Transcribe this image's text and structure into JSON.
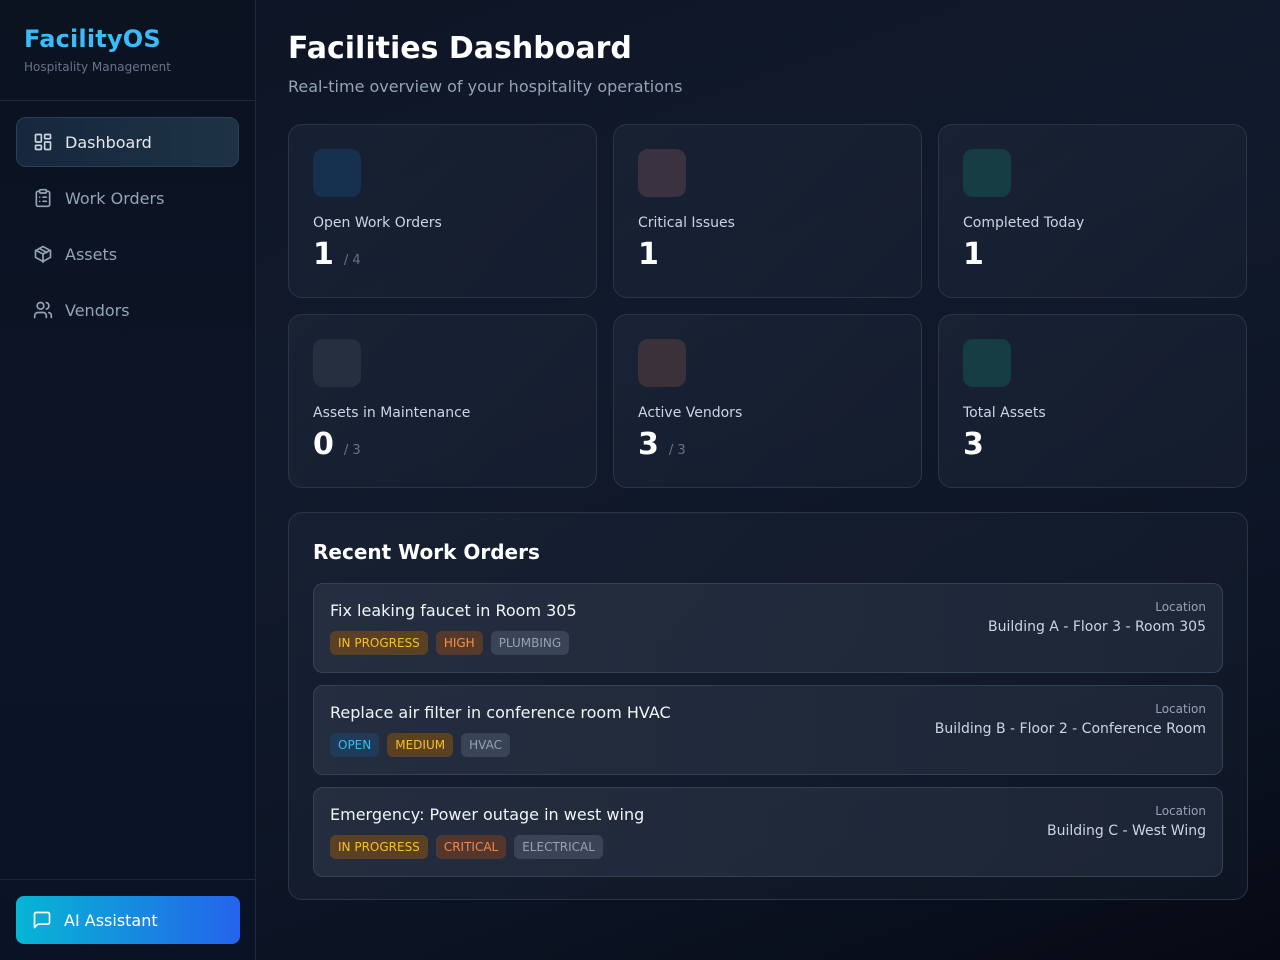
{
  "brand": {
    "title": "FacilityOS",
    "subtitle": "Hospitality Management"
  },
  "nav": {
    "items": [
      {
        "label": "Dashboard",
        "icon": "dashboard-grid-icon",
        "active": true
      },
      {
        "label": "Work Orders",
        "icon": "clipboard-icon"
      },
      {
        "label": "Assets",
        "icon": "box-icon"
      },
      {
        "label": "Vendors",
        "icon": "users-icon"
      }
    ]
  },
  "ai_button": {
    "label": "AI Assistant",
    "icon": "chat-icon"
  },
  "page": {
    "title": "Facilities Dashboard",
    "subtitle": "Real-time overview of your hospitality operations"
  },
  "stats": [
    {
      "label": "Open Work Orders",
      "value": "1",
      "total": "/ 4",
      "icon_color": "#16304f"
    },
    {
      "label": "Critical Issues",
      "value": "1",
      "total": "",
      "icon_color": "#3a3240"
    },
    {
      "label": "Completed Today",
      "value": "1",
      "total": "",
      "icon_color": "#173d44"
    },
    {
      "label": "Assets in Maintenance",
      "value": "0",
      "total": "/ 3",
      "icon_color": "#252f40"
    },
    {
      "label": "Active Vendors",
      "value": "3",
      "total": "/ 3",
      "icon_color": "#3b3138"
    },
    {
      "label": "Total Assets",
      "value": "3",
      "total": "",
      "icon_color": "#173d44"
    }
  ],
  "recent": {
    "title": "Recent Work Orders",
    "location_label": "Location",
    "orders": [
      {
        "title": "Fix leaking faucet in Room 305",
        "status": "IN PROGRESS",
        "priority": "HIGH",
        "category": "PLUMBING",
        "location": "Building A - Floor 3 - Room 305"
      },
      {
        "title": "Replace air filter in conference room HVAC",
        "status": "OPEN",
        "priority": "MEDIUM",
        "category": "HVAC",
        "location": "Building B - Floor 2 - Conference Room"
      },
      {
        "title": "Emergency: Power outage in west wing",
        "status": "IN PROGRESS",
        "priority": "CRITICAL",
        "category": "ELECTRICAL",
        "location": "Building C - West Wing"
      }
    ]
  }
}
